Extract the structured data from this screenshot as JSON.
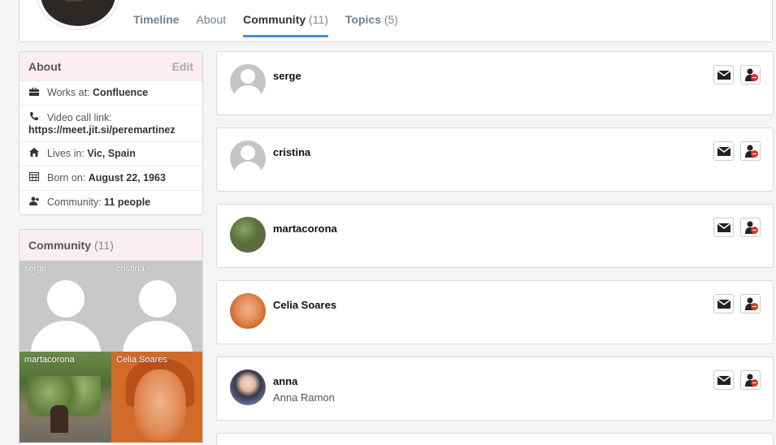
{
  "profile": {
    "tabs": [
      {
        "label": "Timeline",
        "count": ""
      },
      {
        "label": "About",
        "count": ""
      },
      {
        "label": "Community",
        "count": "(11)"
      },
      {
        "label": "Topics",
        "count": "(5)"
      }
    ],
    "active_tab": "Community"
  },
  "about": {
    "title": "About",
    "edit_label": "Edit",
    "rows": [
      {
        "icon": "briefcase-icon",
        "prefix": "Works at: ",
        "value": "Confluence"
      },
      {
        "icon": "phone-icon",
        "prefix": "Video call link:",
        "value": "https://meet.jit.si/peremartinez"
      },
      {
        "icon": "home-icon",
        "prefix": "Lives in: ",
        "value": "Vic, Spain"
      },
      {
        "icon": "calendar-icon",
        "prefix": "Born on: ",
        "value": "August 22, 1963"
      },
      {
        "icon": "community-icon",
        "prefix": "Community: ",
        "value": "11 people"
      }
    ]
  },
  "community": {
    "title": "Community",
    "count": "(11)",
    "grid": [
      "serge",
      "cristina",
      "martacorona",
      "Celia Soares"
    ]
  },
  "members": [
    {
      "username": "serge",
      "fullname": ""
    },
    {
      "username": "cristina",
      "fullname": ""
    },
    {
      "username": "martacorona",
      "fullname": ""
    },
    {
      "username": "Celia Soares",
      "fullname": ""
    },
    {
      "username": "anna",
      "fullname": "Anna Ramon"
    }
  ],
  "colors": {
    "accent": "#4a90d9",
    "remove": "#d9342b",
    "header_bg": "#fbeef0"
  }
}
